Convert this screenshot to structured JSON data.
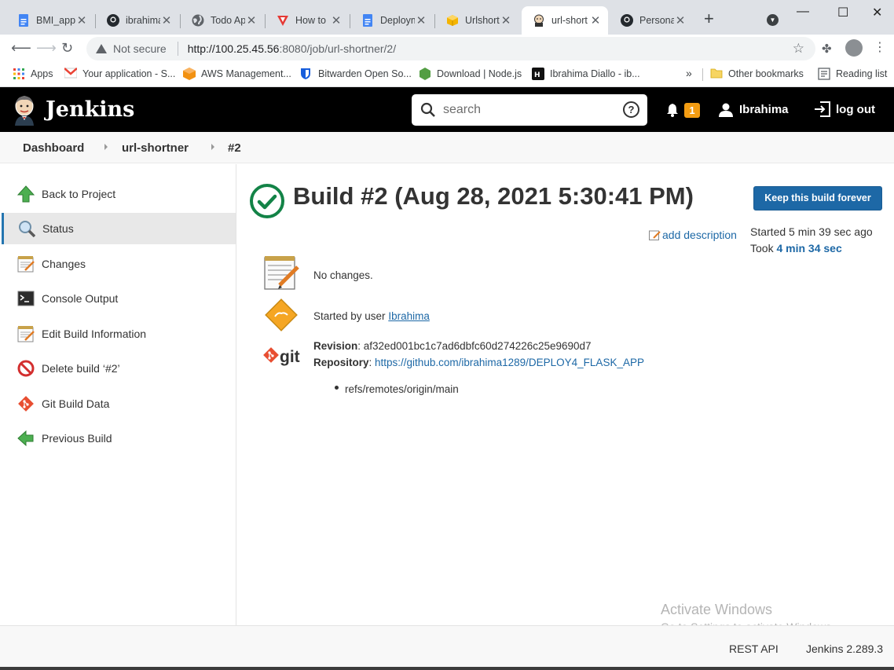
{
  "browser": {
    "tabs": [
      {
        "label": "BMI_app",
        "icon": "docs-icon"
      },
      {
        "label": "ibrahima",
        "icon": "github-icon"
      },
      {
        "label": "Todo Ap",
        "icon": "globe-icon"
      },
      {
        "label": "How to",
        "icon": "vercel-icon"
      },
      {
        "label": "Deploym",
        "icon": "docs-icon"
      },
      {
        "label": "Urlshort",
        "icon": "box-icon"
      },
      {
        "label": "url-short",
        "icon": "jenkins-icon"
      },
      {
        "label": "Personal",
        "icon": "github-icon"
      }
    ],
    "security_label": "Not secure",
    "url_host": "http://100.25.45.56",
    "url_rest": ":8080/job/url-shortner/2/",
    "bookmarks": [
      {
        "label": "Apps",
        "icon": "apps-grid-icon"
      },
      {
        "label": "Your application - S...",
        "icon": "gmail-icon"
      },
      {
        "label": "AWS Management...",
        "icon": "aws-icon"
      },
      {
        "label": "Bitwarden Open So...",
        "icon": "bitwarden-icon"
      },
      {
        "label": "Download | Node.js",
        "icon": "nodejs-icon"
      },
      {
        "label": "Ibrahima Diallo - ib...",
        "icon": "hashnode-icon"
      }
    ],
    "other_bookmarks": "Other bookmarks",
    "reading_list": "Reading list"
  },
  "header": {
    "title": "Jenkins",
    "search_placeholder": "search",
    "notification_count": "1",
    "username": "Ibrahima",
    "logout": "log out"
  },
  "breadcrumb": [
    "Dashboard",
    "url-shortner",
    "#2"
  ],
  "sidebar": {
    "items": [
      {
        "label": "Back to Project"
      },
      {
        "label": "Status"
      },
      {
        "label": "Changes"
      },
      {
        "label": "Console Output"
      },
      {
        "label": "Edit Build Information"
      },
      {
        "label": "Delete build ‘#2’"
      },
      {
        "label": "Git Build Data"
      },
      {
        "label": "Previous Build"
      }
    ]
  },
  "build": {
    "title": "Build #2 (Aug 28, 2021 5:30:41 PM)",
    "keep_button": "Keep this build forever",
    "add_description": "add description",
    "started": "Started 5 min 39 sec ago",
    "took_prefix": "Took ",
    "took_duration": "4 min 34 sec",
    "changes": "No changes.",
    "started_by_prefix": "Started by user ",
    "started_by_user": "Ibrahima",
    "git_logo_text": "git",
    "revision_label": "Revision",
    "revision_value": ": af32ed001bc1c7ad6dbfc60d274226c25e9690d7",
    "repository_label": "Repository",
    "repository_sep": ": ",
    "repository_url": "https://github.com/ibrahima1289/DEPLOY4_FLASK_APP",
    "refs": [
      "refs/remotes/origin/main"
    ]
  },
  "footer": {
    "rest_api": "REST API",
    "version": "Jenkins 2.289.3"
  },
  "watermark": {
    "line1": "Activate Windows",
    "line2": "Go to Settings to activate Windows."
  }
}
